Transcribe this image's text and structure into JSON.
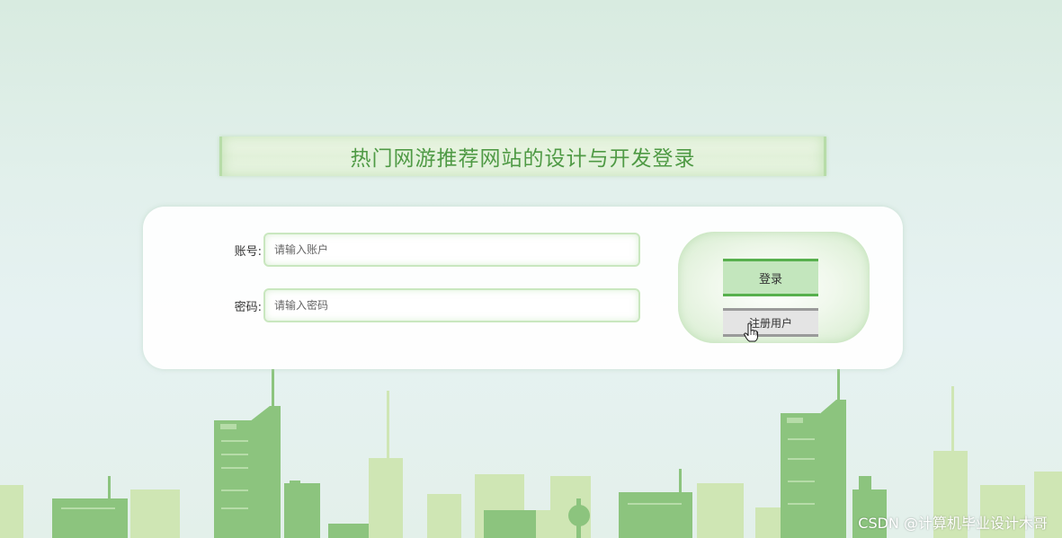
{
  "page": {
    "title": "热门网游推荐网站的设计与开发登录"
  },
  "form": {
    "account_label": "账号:",
    "account_placeholder": "请输入账户",
    "password_label": "密码:",
    "password_placeholder": "请输入密码"
  },
  "buttons": {
    "login_label": "登录",
    "register_label": "注册用户"
  },
  "watermark": {
    "text": "CSDN @计算机毕业设计木哥"
  },
  "colors": {
    "accent_green": "#57b04d",
    "title_green": "#4f9a45",
    "login_button_bg": "#c3e6bd",
    "register_button_bg": "#e4e4e4"
  },
  "icons": {
    "cursor": "hand-pointer-icon"
  }
}
